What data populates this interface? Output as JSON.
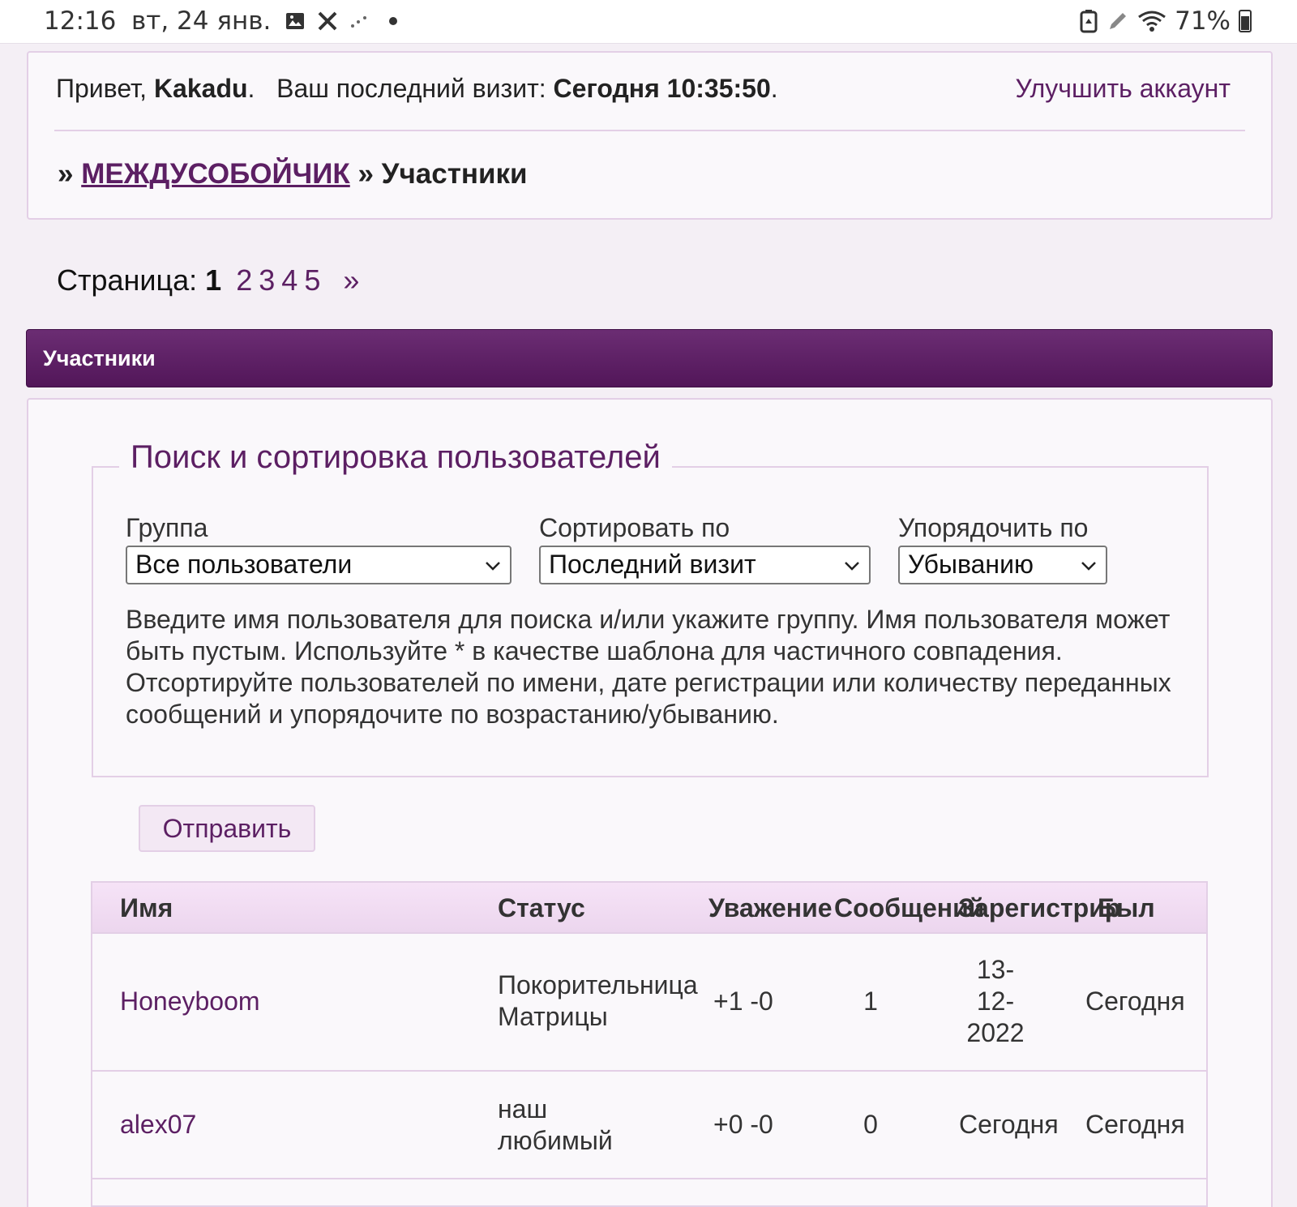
{
  "status_bar": {
    "time": "12:16",
    "date": "вт, 24 янв.",
    "battery": "71%",
    "icons": [
      "image-icon",
      "tools-icon",
      "signal-dots-icon",
      "dot-icon",
      "battery-saver-icon",
      "pen-icon",
      "wifi-icon",
      "battery-icon"
    ]
  },
  "welcome": {
    "greeting": "Привет, ",
    "username": "Kakadu",
    "dot": ".",
    "last_visit_label": "Ваш последний визит: ",
    "last_visit_value": "Сегодня 10:35:50",
    "dot2": ".",
    "upgrade_link": "Улучшить аккаунт"
  },
  "breadcrumb": {
    "sep1": "» ",
    "forum_link": "МЕЖДУСОБОЙЧИК",
    "sep2": " » ",
    "current": "Участники"
  },
  "pagination": {
    "label": "Страница: ",
    "current": "1",
    "pages": [
      "2",
      "3",
      "4",
      "5"
    ],
    "next": "»"
  },
  "section": {
    "title": "Участники"
  },
  "search": {
    "legend": "Поиск и сортировка пользователей",
    "group_label": "Группа",
    "group_value": "Все пользователи",
    "sort_label": "Сортировать по",
    "sort_value": "Последний визит",
    "order_label": "Упорядочить по",
    "order_value": "Убыванию",
    "help": "Введите имя пользователя для поиска и/или укажите группу. Имя пользователя может быть пустым. Используйте * в качестве шаблона для частичного совпадения. Отсортируйте пользователей по имени, дате регистрации или количеству переданных сообщений и упорядочите по возрастанию/убыванию.",
    "submit": "Отправить"
  },
  "table": {
    "headers": [
      "Имя",
      "Статус",
      "Уважение",
      "Сообщений",
      "Зарегистрирован",
      "Был"
    ],
    "rows": [
      {
        "name": "Honeyboom",
        "status_line1": "Покорительница",
        "status_line2": "Матрицы",
        "respect": "+1 -0",
        "posts": "1",
        "reg_line1": "13-",
        "reg_line2": "12-",
        "reg_line3": "2022",
        "last": "Сегодня"
      },
      {
        "name": "alex07",
        "status_line1": "наш",
        "status_line2": "любимый",
        "respect": "+0 -0",
        "posts": "0",
        "reg": "Сегодня",
        "last": "Сегодня"
      }
    ]
  }
}
